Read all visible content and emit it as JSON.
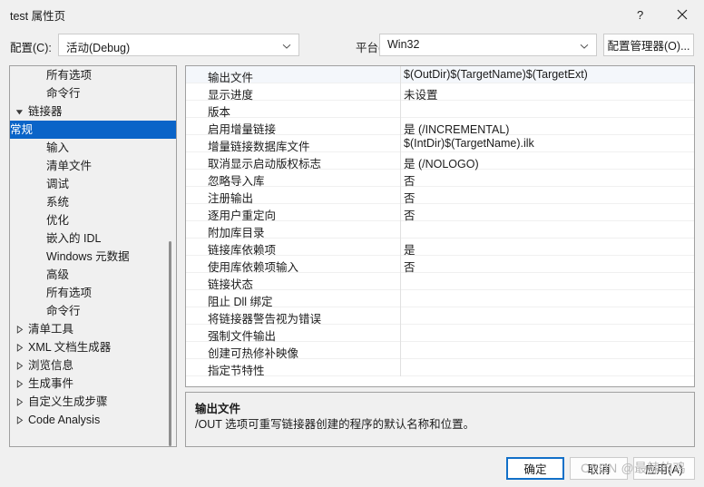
{
  "window": {
    "title": "test 属性页",
    "help_icon": "question-mark-icon",
    "close_icon": "close-icon"
  },
  "toolbar": {
    "config_label": "配置(C):",
    "config_value": "活动(Debug)",
    "platform_label": "平台(P):",
    "platform_value": "Win32",
    "config_manager_label": "配置管理器(O)..."
  },
  "tree": {
    "items": [
      {
        "label": "所有选项",
        "level": 2,
        "expander": "none",
        "selected": false
      },
      {
        "label": "命令行",
        "level": 2,
        "expander": "none",
        "selected": false
      },
      {
        "label": "链接器",
        "level": 1,
        "expander": "expanded",
        "selected": false
      },
      {
        "label": "常规",
        "level": 2,
        "expander": "none",
        "selected": true
      },
      {
        "label": "输入",
        "level": 2,
        "expander": "none",
        "selected": false
      },
      {
        "label": "清单文件",
        "level": 2,
        "expander": "none",
        "selected": false
      },
      {
        "label": "调试",
        "level": 2,
        "expander": "none",
        "selected": false
      },
      {
        "label": "系统",
        "level": 2,
        "expander": "none",
        "selected": false
      },
      {
        "label": "优化",
        "level": 2,
        "expander": "none",
        "selected": false
      },
      {
        "label": "嵌入的 IDL",
        "level": 2,
        "expander": "none",
        "selected": false
      },
      {
        "label": "Windows 元数据",
        "level": 2,
        "expander": "none",
        "selected": false
      },
      {
        "label": "高级",
        "level": 2,
        "expander": "none",
        "selected": false
      },
      {
        "label": "所有选项",
        "level": 2,
        "expander": "none",
        "selected": false
      },
      {
        "label": "命令行",
        "level": 2,
        "expander": "none",
        "selected": false
      },
      {
        "label": "清单工具",
        "level": 1,
        "expander": "collapsed",
        "selected": false
      },
      {
        "label": "XML 文档生成器",
        "level": 1,
        "expander": "collapsed",
        "selected": false
      },
      {
        "label": "浏览信息",
        "level": 1,
        "expander": "collapsed",
        "selected": false
      },
      {
        "label": "生成事件",
        "level": 1,
        "expander": "collapsed",
        "selected": false
      },
      {
        "label": "自定义生成步骤",
        "level": 1,
        "expander": "collapsed",
        "selected": false
      },
      {
        "label": "Code Analysis",
        "level": 1,
        "expander": "collapsed",
        "selected": false
      }
    ]
  },
  "grid": {
    "rows": [
      {
        "name": "输出文件",
        "value": "$(OutDir)$(TargetName)$(TargetExt)",
        "selected": true
      },
      {
        "name": "显示进度",
        "value": "未设置",
        "selected": false
      },
      {
        "name": "版本",
        "value": "",
        "selected": false
      },
      {
        "name": "启用增量链接",
        "value": "是 (/INCREMENTAL)",
        "selected": false
      },
      {
        "name": "增量链接数据库文件",
        "value": "$(IntDir)$(TargetName).ilk",
        "selected": false
      },
      {
        "name": "取消显示启动版权标志",
        "value": "是 (/NOLOGO)",
        "selected": false
      },
      {
        "name": "忽略导入库",
        "value": "否",
        "selected": false
      },
      {
        "name": "注册输出",
        "value": "否",
        "selected": false
      },
      {
        "name": "逐用户重定向",
        "value": "否",
        "selected": false
      },
      {
        "name": "附加库目录",
        "value": "",
        "selected": false
      },
      {
        "name": "链接库依赖项",
        "value": "是",
        "selected": false
      },
      {
        "name": "使用库依赖项输入",
        "value": "否",
        "selected": false
      },
      {
        "name": "链接状态",
        "value": "",
        "selected": false
      },
      {
        "name": "阻止 Dll 绑定",
        "value": "",
        "selected": false
      },
      {
        "name": "将链接器警告视为错误",
        "value": "",
        "selected": false
      },
      {
        "name": "强制文件输出",
        "value": "",
        "selected": false
      },
      {
        "name": "创建可热修补映像",
        "value": "",
        "selected": false
      },
      {
        "name": "指定节特性",
        "value": "",
        "selected": false
      }
    ]
  },
  "description": {
    "title": "输出文件",
    "body": "/OUT 选项可重写链接器创建的程序的默认名称和位置。"
  },
  "footer": {
    "ok_label": "确定",
    "cancel_label": "取消",
    "apply_label": "应用(A)"
  },
  "watermark": {
    "text": "CSDN @最辣的鸡"
  },
  "colors": {
    "accent": "#0a64c8",
    "selected_row": "#f4f7fb",
    "dialog_bg": "#f0f0f0",
    "default_button_border": "#1270c8"
  }
}
